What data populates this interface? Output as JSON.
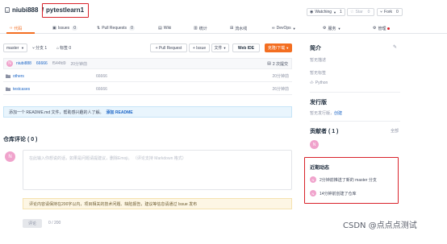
{
  "header": {
    "owner": "niubi888",
    "separator": "/",
    "repo_name": "pytestlearn1",
    "watch_label": "Watching",
    "watch_count": "1",
    "star_label": "Star",
    "star_count": "0",
    "fork_label": "Fork",
    "fork_count": "0"
  },
  "nav_tabs": [
    {
      "label": "代码",
      "active": true
    },
    {
      "label": "Issues",
      "count": "0"
    },
    {
      "label": "Pull Requests",
      "count": "0"
    },
    {
      "label": "Wiki"
    },
    {
      "label": "统计"
    },
    {
      "label": "流水线"
    },
    {
      "label": "DevOps"
    },
    {
      "label": "服务"
    },
    {
      "label": "管理"
    }
  ],
  "toolbar": {
    "branch": "master",
    "branches_label": "分支 1",
    "tags_label": "标签 0",
    "pr_button": "+ Pull Request",
    "issue_button": "+ Issue",
    "file_button": "文件",
    "webide_button": "Web IDE",
    "clone_button": "克隆/下载"
  },
  "commit_bar": {
    "author_initial": "N",
    "author": "niubi888",
    "message": "66666",
    "hash": "f544fd9",
    "time": "20分钟前",
    "commits": "2 次提交"
  },
  "files": [
    {
      "name": "others",
      "message": "66666",
      "time": "20分钟前"
    },
    {
      "name": "testcases",
      "message": "66666",
      "time": "26分钟前"
    }
  ],
  "readme_banner": {
    "text": "添加一个 README.md 文件，帮助感兴趣的人了解。",
    "link": "添加 README"
  },
  "comments": {
    "title": "仓库评论 ( 0 )",
    "avatar_initial": "N",
    "placeholder": "在此输入你想说的话，如果是问题请提建议，删除Emoji。 （评论支持 Markdown 格式）",
    "notice": "评论内容请保持在200字以内，项目相关的技术问题、缺陷报告，建议等信息请通过 Issue 发布",
    "submit_label": "评论",
    "counter": "0 / 200"
  },
  "sidebar": {
    "intro_title": "简介",
    "intro_desc": "暂无描述",
    "intro_tags": "暂无标签",
    "language": "Python",
    "release_title": "发行版",
    "release_text": "暂无发行版，",
    "release_link": "创建",
    "contributors_title": "贡献者 ( 1 )",
    "contributors_all": "全部",
    "contributor_initial": "N",
    "activity_title": "近期动态",
    "activities": [
      {
        "initial": "N",
        "text": "2分钟前推送了新的 master 分支"
      },
      {
        "initial": "N",
        "text": "14分钟前创建了仓库"
      }
    ]
  },
  "watermark": "CSDN @点点点测试",
  "colors": {
    "accent_orange": "#f36e21",
    "link_blue": "#1b65c6",
    "avatar_pink": "#f0a3cc",
    "highlight_red": "#d9222a",
    "readme_bg": "#e9f5fd",
    "notice_bg": "#fdf6e4"
  }
}
